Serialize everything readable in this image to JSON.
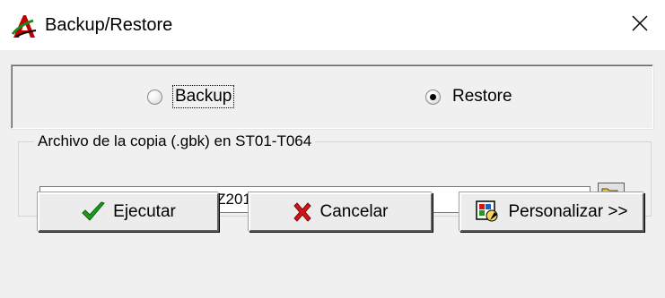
{
  "window": {
    "title": "Backup/Restore",
    "icons": {
      "app": "app-logo-icon",
      "close": "close-icon"
    }
  },
  "mode": {
    "options": [
      {
        "label": "Backup",
        "selected": false,
        "focused": true
      },
      {
        "label": "Restore",
        "selected": true,
        "focused": false
      }
    ]
  },
  "file_group": {
    "legend": "Archivo de la copia (.gbk) en ST01-T064",
    "path_value": "C:\\Visual TNS\\Copias\\XYZ2019-20190410-1137.GBK",
    "browse_icon": "folder-open-icon"
  },
  "buttons": {
    "execute": {
      "label": "Ejecutar",
      "icon": "checkmark-icon"
    },
    "cancel": {
      "label": "Cancelar",
      "icon": "x-mark-icon"
    },
    "customize": {
      "label": "Personalizar >>",
      "icon": "customize-icon"
    }
  },
  "colors": {
    "check_green": "#1e9c1e",
    "cancel_red": "#d01616",
    "folder_yellow": "#f5d65a",
    "dialog_bg": "#f0f0f0"
  }
}
